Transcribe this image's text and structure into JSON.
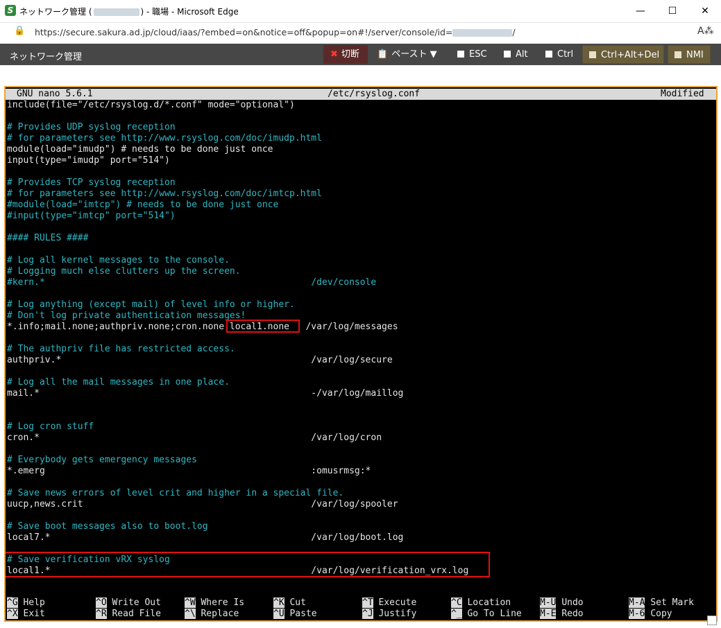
{
  "window": {
    "title_prefix": "ネットワーク管理 (",
    "title_suffix": ") - 職場 - Microsoft Edge",
    "minimize_icon": "minimize-icon",
    "maximize_icon": "maximize-icon",
    "close_icon": "close-icon"
  },
  "address": {
    "url_prefix": "https://secure.sakura.ad.jp/cloud/iaas/?embed=on&notice=off&popup=on#!/server/console/id=",
    "url_suffix": "/"
  },
  "toolbar": {
    "title": "ネットワーク管理",
    "buttons": {
      "cut": "切断",
      "paste": "ペースト ▼",
      "esc": "ESC",
      "alt": "Alt",
      "ctrl": "Ctrl",
      "ctrl_alt_del": "Ctrl+Alt+Del",
      "nmi": "NMI"
    }
  },
  "nano": {
    "version": "GNU nano 5.6.1",
    "filename": "/etc/rsyslog.conf",
    "status": "Modified",
    "lines": [
      {
        "text": "include(file=\"/etc/rsyslog.d/*.conf\" mode=\"optional\")",
        "type": "code"
      },
      {
        "text": "",
        "type": "code"
      },
      {
        "text": "# Provides UDP syslog reception",
        "type": "comment"
      },
      {
        "text": "# for parameters see http://www.rsyslog.com/doc/imudp.html",
        "type": "comment"
      },
      {
        "text": "module(load=\"imudp\") # needs to be done just once",
        "type": "code"
      },
      {
        "text": "input(type=\"imudp\" port=\"514\")",
        "type": "code"
      },
      {
        "text": "",
        "type": "code"
      },
      {
        "text": "# Provides TCP syslog reception",
        "type": "comment"
      },
      {
        "text": "# for parameters see http://www.rsyslog.com/doc/imtcp.html",
        "type": "comment"
      },
      {
        "text": "#module(load=\"imtcp\") # needs to be done just once",
        "type": "comment"
      },
      {
        "text": "#input(type=\"imtcp\" port=\"514\")",
        "type": "comment"
      },
      {
        "text": "",
        "type": "code"
      },
      {
        "text": "#### RULES ####",
        "type": "comment"
      },
      {
        "text": "",
        "type": "code"
      },
      {
        "text": "# Log all kernel messages to the console.",
        "type": "comment"
      },
      {
        "text": "# Logging much else clutters up the screen.",
        "type": "comment"
      },
      {
        "text": "#kern.*                                                 /dev/console",
        "type": "comment"
      },
      {
        "text": "",
        "type": "code"
      },
      {
        "text": "# Log anything (except mail) of level info or higher.",
        "type": "comment"
      },
      {
        "text": "# Don't log private authentication messages!",
        "type": "comment"
      },
      {
        "text": "*.info;mail.none;authpriv.none;cron.none;local1.none   /var/log/messages",
        "type": "code"
      },
      {
        "text": "",
        "type": "code"
      },
      {
        "text": "# The authpriv file has restricted access.",
        "type": "comment"
      },
      {
        "text": "authpriv.*                                              /var/log/secure",
        "type": "code"
      },
      {
        "text": "",
        "type": "code"
      },
      {
        "text": "# Log all the mail messages in one place.",
        "type": "comment"
      },
      {
        "text": "mail.*                                                  -/var/log/maillog",
        "type": "code"
      },
      {
        "text": "",
        "type": "code"
      },
      {
        "text": "",
        "type": "code"
      },
      {
        "text": "# Log cron stuff",
        "type": "comment"
      },
      {
        "text": "cron.*                                                  /var/log/cron",
        "type": "code"
      },
      {
        "text": "",
        "type": "code"
      },
      {
        "text": "# Everybody gets emergency messages",
        "type": "comment"
      },
      {
        "text": "*.emerg                                                 :omusrmsg:*",
        "type": "code"
      },
      {
        "text": "",
        "type": "code"
      },
      {
        "text": "# Save news errors of level crit and higher in a special file.",
        "type": "comment"
      },
      {
        "text": "uucp,news.crit                                          /var/log/spooler",
        "type": "code"
      },
      {
        "text": "",
        "type": "code"
      },
      {
        "text": "# Save boot messages also to boot.log",
        "type": "comment"
      },
      {
        "text": "local7.*                                                /var/log/boot.log",
        "type": "code"
      },
      {
        "text": "",
        "type": "code"
      },
      {
        "text": "# Save verification vRX syslog",
        "type": "comment"
      },
      {
        "text": "local1.*                                                /var/log/verification_vrx.log",
        "type": "code"
      },
      {
        "text": "",
        "type": "code"
      },
      {
        "text": "_",
        "type": "code"
      }
    ],
    "shortcuts": [
      [
        {
          "key": "^G",
          "label": "Help"
        },
        {
          "key": "^X",
          "label": "Exit"
        }
      ],
      [
        {
          "key": "^O",
          "label": "Write Out"
        },
        {
          "key": "^R",
          "label": "Read File"
        }
      ],
      [
        {
          "key": "^W",
          "label": "Where Is"
        },
        {
          "key": "^\\",
          "label": "Replace"
        }
      ],
      [
        {
          "key": "^K",
          "label": "Cut"
        },
        {
          "key": "^U",
          "label": "Paste"
        }
      ],
      [
        {
          "key": "^T",
          "label": "Execute"
        },
        {
          "key": "^J",
          "label": "Justify"
        }
      ],
      [
        {
          "key": "^C",
          "label": "Location"
        },
        {
          "key": "^_",
          "label": "Go To Line"
        }
      ],
      [
        {
          "key": "M-U",
          "label": "Undo"
        },
        {
          "key": "M-E",
          "label": "Redo"
        }
      ],
      [
        {
          "key": "M-A",
          "label": "Set Mark"
        },
        {
          "key": "M-6",
          "label": "Copy"
        }
      ]
    ]
  },
  "colors": {
    "comment": "#2fb7c4",
    "frame": "#e8a43a",
    "highlight_box": "#e01010"
  }
}
